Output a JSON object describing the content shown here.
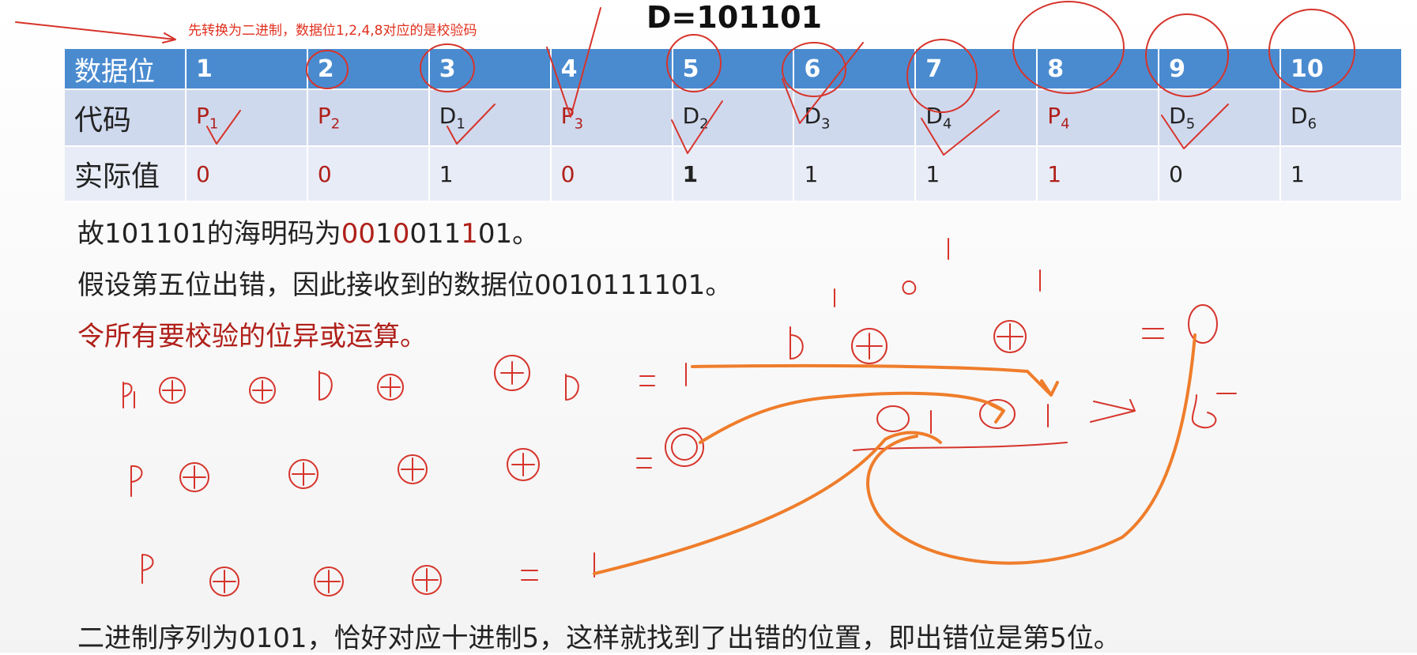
{
  "note": "先转换为二进制，数据位1,2,4,8对应的是校验码",
  "title": "D=101101",
  "table": {
    "header_label": "数据位",
    "positions": [
      "1",
      "2",
      "3",
      "4",
      "5",
      "6",
      "7",
      "8",
      "9",
      "10"
    ],
    "code_label": "代码",
    "codes": [
      {
        "letter": "P",
        "sub": "1",
        "kind": "parity"
      },
      {
        "letter": "P",
        "sub": "2",
        "kind": "parity"
      },
      {
        "letter": "D",
        "sub": "1",
        "kind": "data"
      },
      {
        "letter": "P",
        "sub": "3",
        "kind": "parity"
      },
      {
        "letter": "D",
        "sub": "2",
        "kind": "data"
      },
      {
        "letter": "D",
        "sub": "3",
        "kind": "data"
      },
      {
        "letter": "D",
        "sub": "4",
        "kind": "data"
      },
      {
        "letter": "P",
        "sub": "4",
        "kind": "parity"
      },
      {
        "letter": "D",
        "sub": "5",
        "kind": "data"
      },
      {
        "letter": "D",
        "sub": "6",
        "kind": "data"
      }
    ],
    "value_label": "实际值",
    "values": [
      "0",
      "0",
      "1",
      "0",
      "1",
      "1",
      "1",
      "1",
      "0",
      "1"
    ]
  },
  "lines": {
    "l1_prefix": "故101101的海明码为",
    "l1_code": [
      {
        "t": "00",
        "red": true
      },
      {
        "t": "1",
        "red": false
      },
      {
        "t": "0",
        "red": true
      },
      {
        "t": "011",
        "red": false
      },
      {
        "t": "1",
        "red": true
      },
      {
        "t": "01",
        "red": false
      }
    ],
    "l1_suffix": "。",
    "l2": "假设第五位出错，因此接收到的数据位0010111101。",
    "l3": "令所有要校验的位异或运算。",
    "l4": "二进制序列为0101，恰好对应十进制5，这样就找到了出错的位置，即出错位是第5位。"
  },
  "colors": {
    "header_blue": "#4a8bd0",
    "code_row": "#cfd9ee",
    "value_row": "#e8ecf6",
    "ink_red": "#d6342b",
    "ink_orange": "#ef7d2b"
  }
}
